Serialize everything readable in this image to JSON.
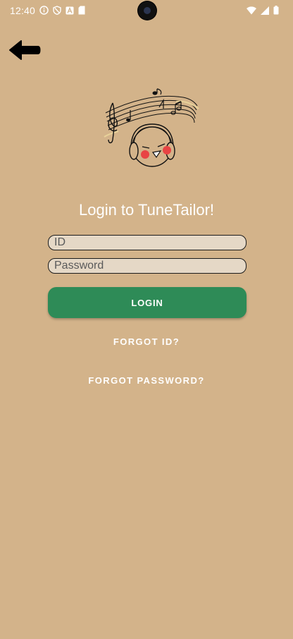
{
  "status_bar": {
    "time": "12:40",
    "left_icons": [
      "info-icon",
      "shield-icon",
      "font-icon",
      "sim-card-icon"
    ],
    "right_icons": [
      "wifi-icon",
      "signal-icon",
      "battery-icon"
    ]
  },
  "header": {
    "back_icon": "arrow-left-icon"
  },
  "logo": {
    "icon": "music-face-logo"
  },
  "login": {
    "title": "Login to TuneTailor!",
    "id_placeholder": "ID",
    "id_value": "",
    "password_placeholder": "Password",
    "password_value": "",
    "login_label": "LOGIN",
    "forgot_id_label": "FORGOT ID?",
    "forgot_password_label": "FORGOT PASSWORD?"
  },
  "colors": {
    "background": "#D3B38A",
    "input_bg": "#E5D8C6",
    "button": "#2E8B57",
    "text_light": "#FFFFFF"
  }
}
